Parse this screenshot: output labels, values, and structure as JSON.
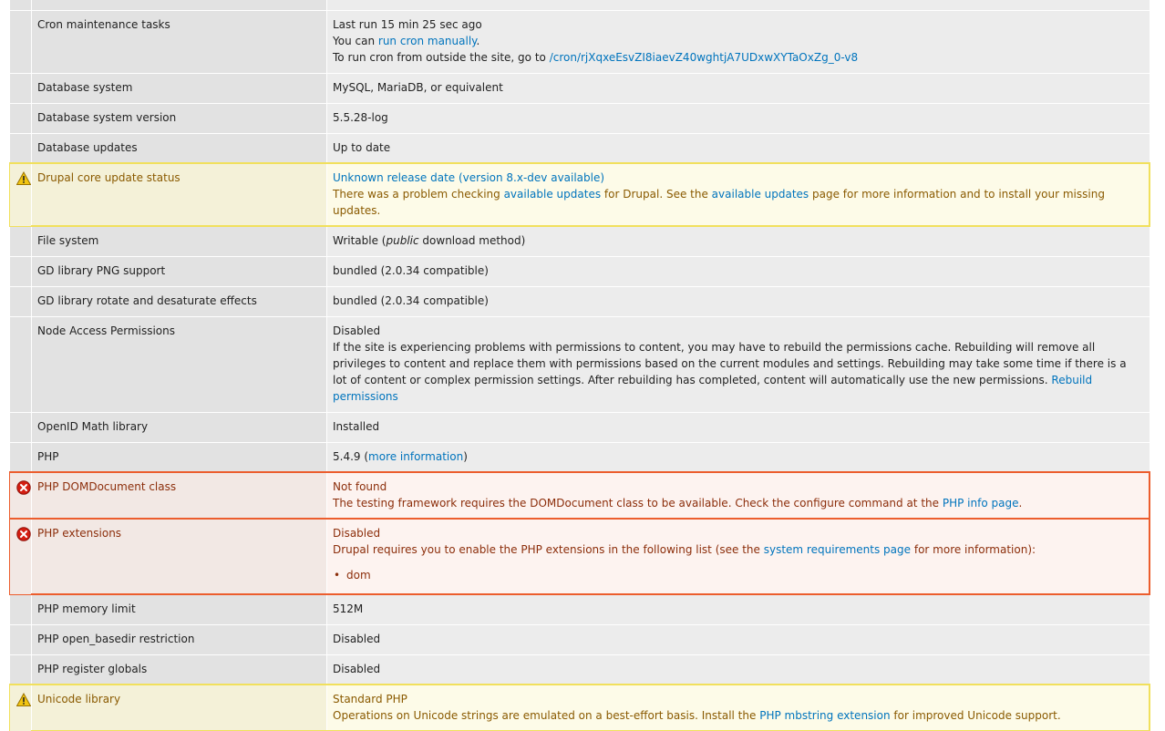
{
  "colors": {
    "link": "#0074bd",
    "warning_border": "#f1e05c",
    "error_border": "#ec5d2d",
    "warning_text": "#8a5a00",
    "error_text": "#8c2e0b"
  },
  "icons": {
    "warning": "warning-triangle-icon",
    "error": "error-x-icon",
    "bullet": "bullet-icon"
  },
  "rows": {
    "top": {
      "title": "",
      "value": ""
    },
    "cron": {
      "title": "Cron maintenance tasks",
      "last_run": "Last run 15 min 25 sec ago",
      "manual_prefix": "You can",
      "manual_link": "run cron manually",
      "manual_suffix": ".",
      "outside_prefix": "To run cron from outside the site, go to",
      "outside_link": "/cron/rjXqxeEsvZI8iaevZ40wghtjA7UDxwXYTaOxZg_0-v8"
    },
    "db_system": {
      "title": "Database system",
      "value": "MySQL, MariaDB, or equivalent"
    },
    "db_version": {
      "title": "Database system version",
      "value": "5.5.28-log"
    },
    "db_updates": {
      "title": "Database updates",
      "value": "Up to date"
    },
    "core_update": {
      "title": "Drupal core update status",
      "value_link": "Unknown release date (version 8.x-dev available)",
      "desc_part1": "There was a problem checking",
      "desc_link1": "available updates",
      "desc_part2": "for Drupal. See the",
      "desc_link2": "available updates",
      "desc_part3": "page for more information and to install your missing updates."
    },
    "file_system": {
      "title": "File system",
      "value_prefix": "Writable (",
      "value_em": "public",
      "value_suffix": "download method)"
    },
    "gd_png": {
      "title": "GD library PNG support",
      "value": "bundled (2.0.34 compatible)"
    },
    "gd_rotate": {
      "title": "GD library rotate and desaturate effects",
      "value": "bundled (2.0.34 compatible)"
    },
    "node_access": {
      "title": "Node Access Permissions",
      "value": "Disabled",
      "desc": "If the site is experiencing problems with permissions to content, you may have to rebuild the permissions cache. Rebuilding will remove all privileges to content and replace them with permissions based on the current modules and settings. Rebuilding may take some time if there is a lot of content or complex permission settings. After rebuilding has completed, content will automatically use the new permissions.",
      "link": "Rebuild permissions"
    },
    "openid": {
      "title": "OpenID Math library",
      "value": "Installed"
    },
    "php": {
      "title": "PHP",
      "value_prefix": "5.4.9 (",
      "value_link": "more information",
      "value_suffix": ")"
    },
    "php_dom": {
      "title": "PHP DOMDocument class",
      "value": "Not found",
      "desc_prefix": "The testing framework requires the DOMDocument class to be available. Check the configure command at the",
      "desc_link": "PHP info page",
      "desc_suffix": "."
    },
    "php_ext": {
      "title": "PHP extensions",
      "value": "Disabled",
      "desc_prefix": "Drupal requires you to enable the PHP extensions in the following list (see the",
      "desc_link": "system requirements page",
      "desc_suffix": "for more information):",
      "list": [
        "dom"
      ]
    },
    "php_memory": {
      "title": "PHP memory limit",
      "value": "512M"
    },
    "php_basedir": {
      "title": "PHP open_basedir restriction",
      "value": "Disabled"
    },
    "php_globals": {
      "title": "PHP register globals",
      "value": "Disabled"
    },
    "unicode": {
      "title": "Unicode library",
      "value": "Standard PHP",
      "desc_prefix": "Operations on Unicode strings are emulated on a best-effort basis. Install the",
      "desc_link": "PHP mbstring extension",
      "desc_suffix": "for improved Unicode support."
    }
  }
}
